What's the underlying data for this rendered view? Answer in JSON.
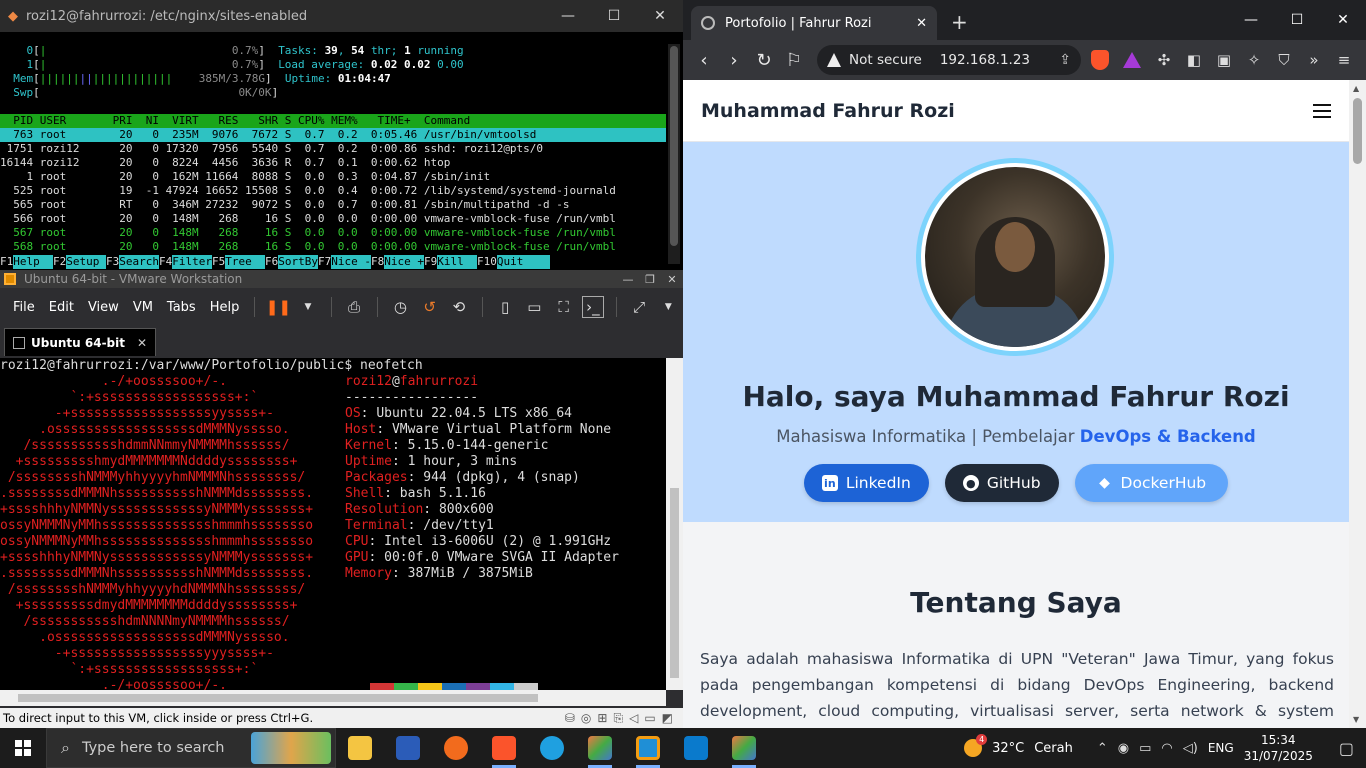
{
  "terminal": {
    "title": "rozi12@fahrurrozi: /etc/nginx/sites-enabled",
    "meters": [
      {
        "label": "0",
        "value": "0.7%"
      },
      {
        "label": "1",
        "value": "0.7%"
      },
      {
        "label": "Mem",
        "value": "385M/3.78G"
      },
      {
        "label": "Swp",
        "value": "0K/0K"
      }
    ],
    "tasks_label": "Tasks:",
    "tasks_value": "39",
    "thr_value": "54",
    "thr_label": "thr;",
    "running_value": "1",
    "running_label": "running",
    "load_label": "Load average:",
    "load_values": [
      "0.02",
      "0.02",
      "0.00"
    ],
    "uptime_label": "Uptime:",
    "uptime_value": "01:04:47",
    "columns": "  PID USER       PRI  NI  VIRT   RES   SHR S CPU% MEM%   TIME+  Command",
    "processes": [
      "  763 root        20   0  235M  9076  7672 S  0.7  0.2  0:05.46 /usr/bin/vmtoolsd",
      " 1751 rozi12      20   0 17320  7956  5540 S  0.7  0.2  0:00.86 sshd: rozi12@pts/0",
      "16144 rozi12      20   0  8224  4456  3636 R  0.7  0.1  0:00.62 htop",
      "    1 root        20   0  162M 11664  8088 S  0.0  0.3  0:04.87 /sbin/init",
      "  525 root        19  -1 47924 16652 15508 S  0.0  0.4  0:00.72 /lib/systemd/systemd-journald",
      "  565 root        RT   0  346M 27232  9072 S  0.0  0.7  0:00.81 /sbin/multipathd -d -s",
      "  566 root        20   0  148M   268    16 S  0.0  0.0  0:00.00 vmware-vmblock-fuse /run/vmbl",
      "  567 root        20   0  148M   268    16 S  0.0  0.0  0:00.00 vmware-vmblock-fuse /run/vmbl",
      "  568 root        20   0  148M   268    16 S  0.0  0.0  0:00.00 vmware-vmblock-fuse /run/vmbl"
    ],
    "fkeys": [
      {
        "num": "F1",
        "label": "Help  "
      },
      {
        "num": "F2",
        "label": "Setup "
      },
      {
        "num": "F3",
        "label": "Search"
      },
      {
        "num": "F4",
        "label": "Filter"
      },
      {
        "num": "F5",
        "label": "Tree  "
      },
      {
        "num": "F6",
        "label": "SortBy"
      },
      {
        "num": "F7",
        "label": "Nice -"
      },
      {
        "num": "F8",
        "label": "Nice +"
      },
      {
        "num": "F9",
        "label": "Kill  "
      },
      {
        "num": "F10",
        "label": "Quit    "
      }
    ]
  },
  "vmware": {
    "title": "Ubuntu 64-bit - VMware Workstation",
    "menu": [
      "File",
      "Edit",
      "View",
      "VM",
      "Tabs",
      "Help"
    ],
    "tab_label": "Ubuntu 64-bit",
    "prompt": "rozi12@fahrurrozi:/var/www/Portofolio/public$ neofetch",
    "neofetch": {
      "user": "rozi12",
      "host": "fahrurrozi",
      "separator": "-----------------",
      "info": [
        {
          "key": "OS",
          "value": "Ubuntu 22.04.5 LTS x86_64"
        },
        {
          "key": "Host",
          "value": "VMware Virtual Platform None"
        },
        {
          "key": "Kernel",
          "value": "5.15.0-144-generic"
        },
        {
          "key": "Uptime",
          "value": "1 hour, 3 mins"
        },
        {
          "key": "Packages",
          "value": "944 (dpkg), 4 (snap)"
        },
        {
          "key": "Shell",
          "value": "bash 5.1.16"
        },
        {
          "key": "Resolution",
          "value": "800x600"
        },
        {
          "key": "Terminal",
          "value": "/dev/tty1"
        },
        {
          "key": "CPU",
          "value": "Intel i3-6006U (2) @ 1.991GHz"
        },
        {
          "key": "GPU",
          "value": "00:0f.0 VMware SVGA II Adapter"
        },
        {
          "key": "Memory",
          "value": "387MiB / 3875MiB"
        }
      ],
      "logo": [
        "             .-/+oossssoo+/-.",
        "         `:+ssssssssssssssssss+:`",
        "       -+ssssssssssssssssssyyssss+-",
        "     .ossssssssssssssssssdMMMNysssso.",
        "   /ssssssssssshdmmNNmmyNMMMMhssssss/",
        "  +ssssssssshmydMMMMMMMNddddyssssssss+",
        " /sssssssshNMMMyhhyyyyhmNMMMNhssssssss/",
        ".ssssssssdMMMNhsssssssssshNMMMdssssssss.",
        "+sssshhhyNMMNyssssssssssssyNMMMysssssss+",
        "ossyNMMMNyMMhsssssssssssssshmmmhssssssso",
        "ossyNMMMNyMMhsssssssssssssshmmmhssssssso",
        "+sssshhhyNMMNyssssssssssssyNMMMysssssss+",
        ".ssssssssdMMMNhsssssssssshNMMMdssssssss.",
        " /sssssssshNMMMyhhyyyyhdNMMMNhssssssss/",
        "  +sssssssssdmydMMMMMMMMddddyssssssss+",
        "   /ssssssssssshdmNNNNmyNMMMMhssssss/",
        "     .ossssssssssssssssssdMMMNysssso.",
        "       -+sssssssssssssssssyyyssss+-",
        "         `:+ssssssssssssssssss+:`",
        "             .-/+oossssoo+/-."
      ],
      "palette": [
        "#d33636",
        "#35b54a",
        "#f5c518",
        "#1b6fb5",
        "#7c3e96",
        "#33b5e5",
        "#cccccc"
      ]
    },
    "status": "To direct input to this VM, click inside or press Ctrl+G."
  },
  "browser": {
    "tab_title": "Portofolio | Fahrur Rozi",
    "not_secure": "Not secure",
    "url": "192.168.1.23"
  },
  "site": {
    "brand": "Muhammad Fahrur Rozi",
    "hero_title": "Halo, saya Muhammad Fahrur Rozi",
    "hero_sub_prefix": "Mahasiswa Informatika | Pembelajar ",
    "hero_sub_accent": "DevOps & Backend",
    "buttons": {
      "linkedin": "LinkedIn",
      "github": "GitHub",
      "docker": "DockerHub"
    },
    "about_title": "Tentang Saya",
    "about_text": "Saya adalah mahasiswa Informatika di UPN \"Veteran\" Jawa Timur, yang fokus pada pengembangan kompetensi di bidang DevOps Engineering, backend development, cloud computing, virtualisasi server, serta network & system administration. Saya juga memiliki"
  },
  "taskbar": {
    "search_placeholder": "Type here to search",
    "weather_badge": "4",
    "temperature": "32°C",
    "weather": "Cerah",
    "language": "ENG",
    "time": "15:34",
    "date": "31/07/2025"
  }
}
